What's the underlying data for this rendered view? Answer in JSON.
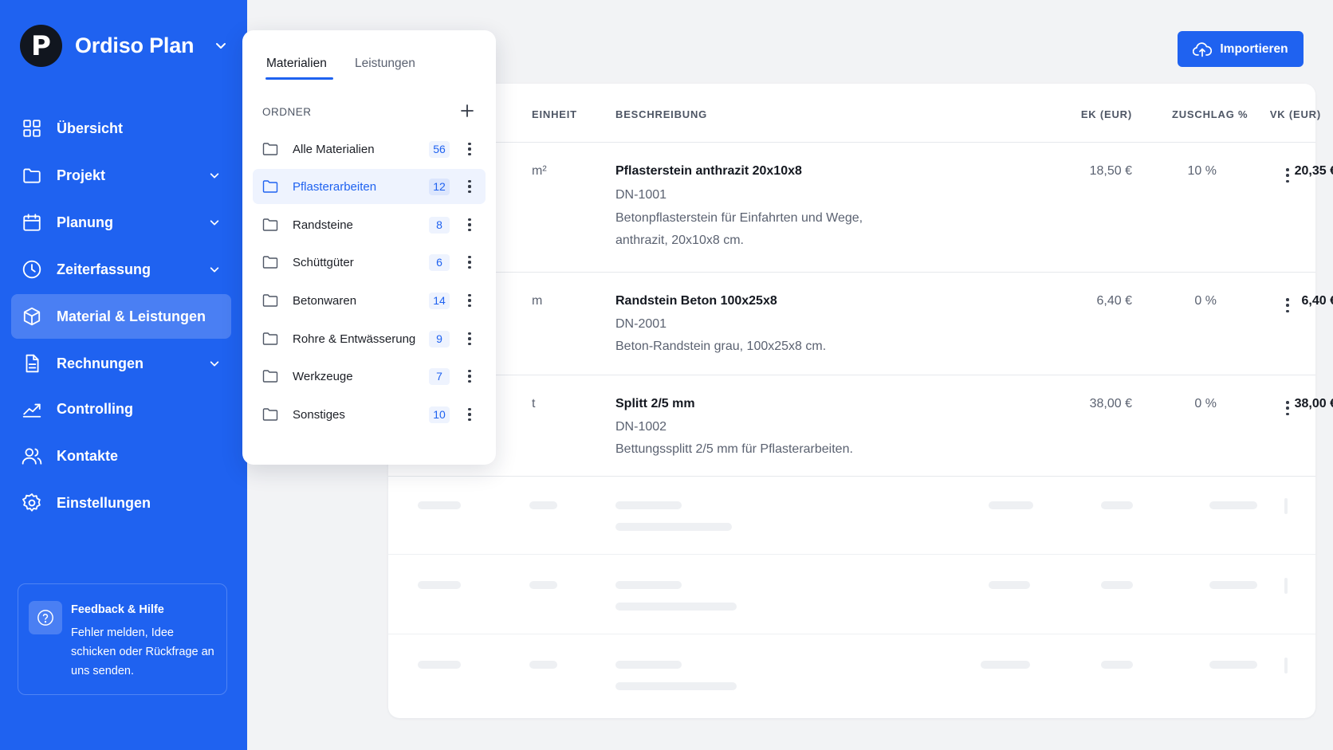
{
  "app": {
    "name": "Ordiso Plan",
    "logo_letter": "P"
  },
  "sidebar": {
    "items": [
      {
        "label": "Übersicht",
        "icon": "grid-icon",
        "has_chevron": false
      },
      {
        "label": "Projekt",
        "icon": "folder-icon",
        "has_chevron": true
      },
      {
        "label": "Planung",
        "icon": "calendar-icon",
        "has_chevron": true
      },
      {
        "label": "Zeiterfassung",
        "icon": "clock-icon",
        "has_chevron": true
      },
      {
        "label": "Material & Leistungen",
        "icon": "box-icon",
        "has_chevron": false,
        "active": true
      },
      {
        "label": "Rechnungen",
        "icon": "document-icon",
        "has_chevron": true
      },
      {
        "label": "Controlling",
        "icon": "chart-icon",
        "has_chevron": false
      },
      {
        "label": "Kontakte",
        "icon": "users-icon",
        "has_chevron": false
      },
      {
        "label": "Einstellungen",
        "icon": "gear-icon",
        "has_chevron": false
      }
    ],
    "feedback": {
      "title": "Feedback & Hilfe",
      "text": "Fehler melden, Idee schicken oder Rückfrage an uns senden.",
      "icon": "help-icon"
    }
  },
  "toolbar": {
    "import_label": "Importieren",
    "import_icon": "cloud-upload-icon"
  },
  "folder_panel": {
    "tabs": [
      {
        "label": "Materialien",
        "active": true
      },
      {
        "label": "Leistungen",
        "active": false
      }
    ],
    "header": "ORDNER",
    "folders": [
      {
        "name": "Alle Materialien",
        "count": "56"
      },
      {
        "name": "Pflasterarbeiten",
        "count": "12",
        "active": true
      },
      {
        "name": "Randsteine",
        "count": "8"
      },
      {
        "name": "Schüttgüter",
        "count": "6"
      },
      {
        "name": "Betonwaren",
        "count": "14"
      },
      {
        "name": "Rohre & Entwässerung",
        "count": "9"
      },
      {
        "name": "Werkzeuge",
        "count": "7"
      },
      {
        "name": "Sonstiges",
        "count": "10"
      }
    ]
  },
  "table": {
    "columns": {
      "einheit": "EINHEIT",
      "beschreibung": "BESCHREIBUNG",
      "ek": "EK (EUR)",
      "zuschlag": "ZUSCHLAG %",
      "vk": "VK (EUR)"
    },
    "rows": [
      {
        "unit": "m²",
        "name": "Pflasterstein anthrazit 20x10x8",
        "code": "DN-1001",
        "desc_line1": "Betonpflasterstein für Einfahrten und Wege,",
        "desc_line2": "anthrazit, 20x10x8 cm.",
        "ek": "18,50 €",
        "zuschlag": "10 %",
        "vk": "20,35 €"
      },
      {
        "unit": "m",
        "name": "Randstein Beton 100x25x8",
        "code": "DN-2001",
        "desc_line1": "Beton-Randstein grau, 100x25x8 cm.",
        "desc_line2": "",
        "ek": "6,40 €",
        "zuschlag": "0 %",
        "vk": "6,40 €"
      },
      {
        "unit": "t",
        "name": "Splitt 2/5 mm",
        "code": "DN-1002",
        "desc_line1": "Bettungssplitt 2/5 mm für Pflasterarbeiten.",
        "desc_line2": "",
        "ek": "38,00 €",
        "zuschlag": "0 %",
        "vk": "38,00 €"
      }
    ]
  },
  "colors": {
    "primary": "#1f62f0",
    "sidebar_active": "#4a7ff3",
    "background": "#f2f3f5",
    "text": "#141820"
  }
}
